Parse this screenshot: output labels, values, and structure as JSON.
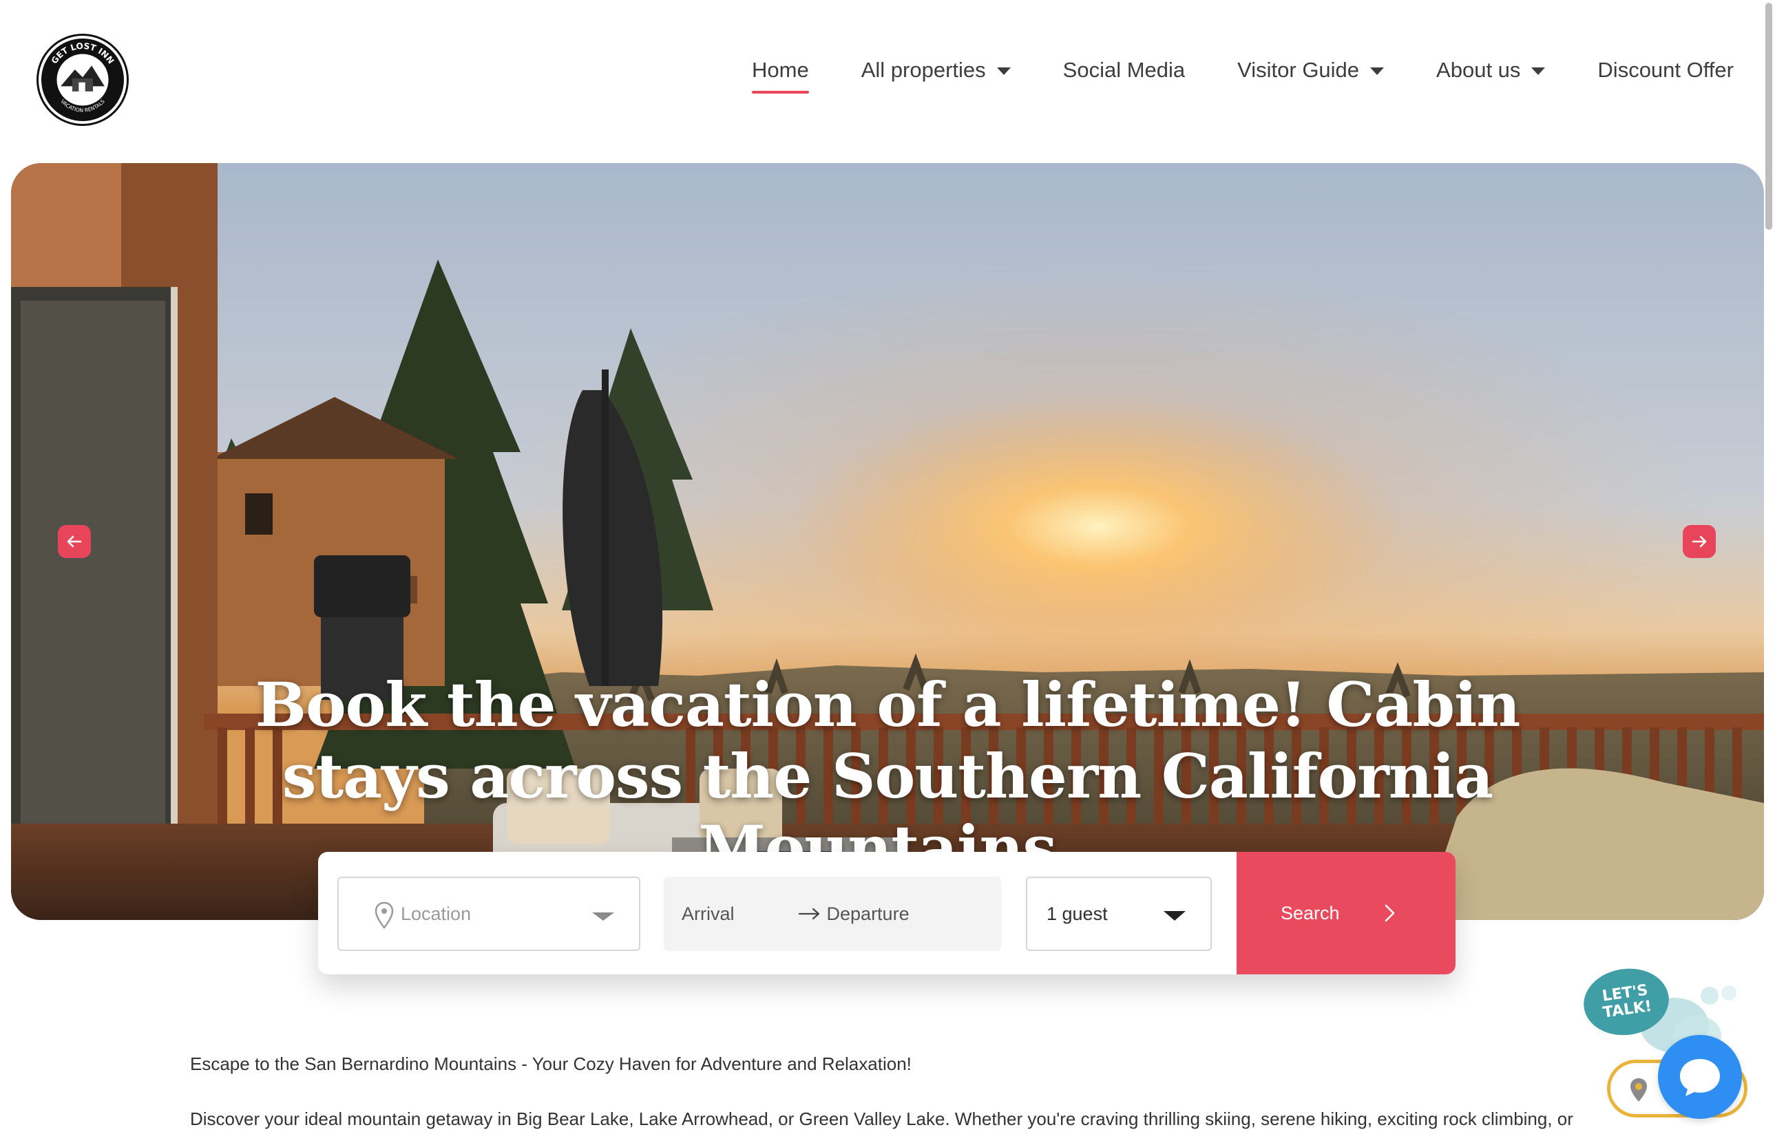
{
  "nav": {
    "items": [
      {
        "label": "Home",
        "active": true,
        "dropdown": false
      },
      {
        "label": "All properties",
        "active": false,
        "dropdown": true
      },
      {
        "label": "Social Media",
        "active": false,
        "dropdown": false
      },
      {
        "label": "Visitor Guide",
        "active": false,
        "dropdown": true
      },
      {
        "label": "About us",
        "active": false,
        "dropdown": true
      },
      {
        "label": "Discount Offer",
        "active": false,
        "dropdown": false
      }
    ]
  },
  "logo": {
    "text_top": "GET LOST INN",
    "text_bottom": "VACATION RENTALS"
  },
  "hero": {
    "title": "Book the vacation of a lifetime! Cabin stays across the Southern California Mountains."
  },
  "search": {
    "location_placeholder": "Location",
    "arrival": "Arrival",
    "departure": "Departure",
    "guests": "1 guest",
    "button": "Search"
  },
  "content": {
    "paragraph_1": "Escape to the San Bernardino Mountains - Your Cozy Haven for Adventure and Relaxation!",
    "paragraph_2": "Discover your ideal mountain getaway in Big Bear Lake, Lake Arrowhead, or Green Valley Lake. Whether you're craving thrilling skiing, serene hiking, exciting rock climbing, or"
  },
  "chat": {
    "talk_label_line1": "LET'S",
    "talk_label_line2": "TALK!"
  },
  "colors": {
    "accent": "#e8445a",
    "chat_blue": "#2f8ef1",
    "chat_teal": "#3f9ea6",
    "chat_gold": "#e9b43a"
  }
}
